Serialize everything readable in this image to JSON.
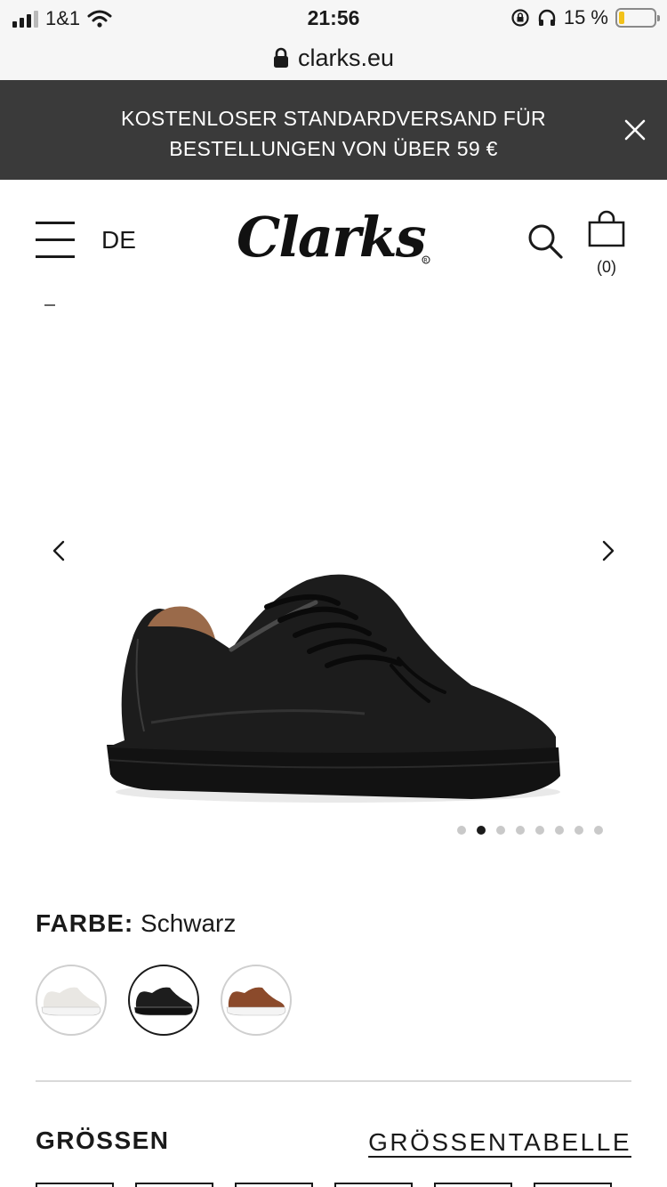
{
  "status_bar": {
    "carrier": "1&1",
    "time": "21:56",
    "battery_percent": "15 %",
    "battery_level": 0.15
  },
  "url_bar": {
    "domain": "clarks.eu"
  },
  "promo": {
    "text": "KOSTENLOSER STANDARDVERSAND FÜR BESTELLUNGEN VON ÜBER 59 €"
  },
  "header": {
    "language": "DE",
    "logo_text": "Clarks",
    "cart_count": "(0)"
  },
  "gallery": {
    "total_images": 8,
    "active_index": 1
  },
  "color": {
    "label": "FARBE:",
    "value": "Schwarz",
    "swatches": [
      {
        "name": "white",
        "color": "#e9e7e3"
      },
      {
        "name": "black",
        "color": "#1d1d1d",
        "selected": true
      },
      {
        "name": "tan",
        "color": "#8b4a2b"
      }
    ]
  },
  "sizes": {
    "title": "GRÖSSEN",
    "chart_link": "GRÖSSENTABELLE"
  },
  "icons": [
    "signal-icon",
    "wifi-icon",
    "lock-icon",
    "rotation-lock-icon",
    "headphones-icon",
    "battery-icon",
    "close-icon",
    "menu-icon",
    "search-icon",
    "shopping-bag-icon",
    "chevron-left-icon",
    "chevron-right-icon"
  ],
  "colors": {
    "banner_bg": "#3a3a3a",
    "text": "#1a1a1a",
    "battery": "#f2c21b"
  }
}
